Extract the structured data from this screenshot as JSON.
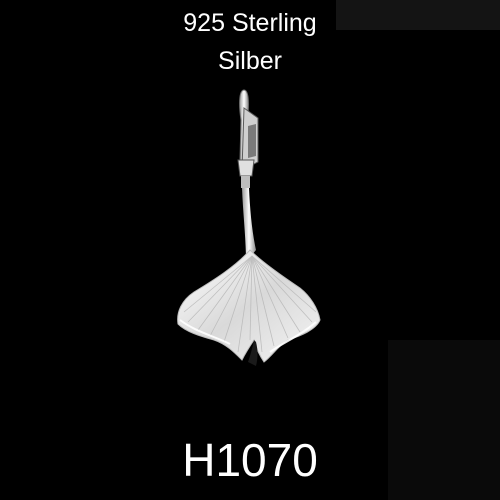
{
  "caption": {
    "line1": "925 Sterling",
    "line2": "Silber"
  },
  "product_code": "H1070",
  "image": {
    "subject": "ginkgo-leaf-pendant",
    "background_color": "#000000",
    "text_color": "#ffffff",
    "metal_color": "#e8e8e8"
  }
}
